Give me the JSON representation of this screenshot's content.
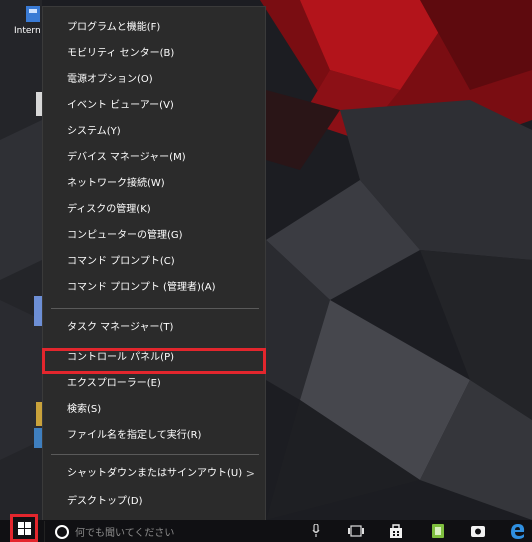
{
  "desktop": {
    "shortcut_label": "Intern"
  },
  "context_menu": {
    "groups": [
      [
        {
          "label": "プログラムと機能(F)"
        },
        {
          "label": "モビリティ センター(B)"
        },
        {
          "label": "電源オプション(O)"
        },
        {
          "label": "イベント ビューアー(V)"
        },
        {
          "label": "システム(Y)"
        },
        {
          "label": "デバイス マネージャー(M)"
        },
        {
          "label": "ネットワーク接続(W)"
        },
        {
          "label": "ディスクの管理(K)"
        },
        {
          "label": "コンピューターの管理(G)"
        },
        {
          "label": "コマンド プロンプト(C)"
        },
        {
          "label": "コマンド プロンプト (管理者)(A)"
        }
      ],
      [
        {
          "label": "タスク マネージャー(T)"
        },
        {
          "label": "コントロール パネル(P)",
          "highlighted": true
        },
        {
          "label": "エクスプローラー(E)"
        },
        {
          "label": "検索(S)"
        },
        {
          "label": "ファイル名を指定して実行(R)"
        }
      ],
      [
        {
          "label": "シャットダウンまたはサインアウト(U)",
          "submenu": true
        },
        {
          "label": "デスクトップ(D)"
        }
      ]
    ],
    "highlight_color": "#e3262d"
  },
  "taskbar": {
    "search_placeholder": "何でも聞いてください",
    "icons": [
      "mic-icon",
      "task-view-icon",
      "store-icon",
      "app-icon",
      "camera-icon",
      "edge-icon"
    ]
  }
}
